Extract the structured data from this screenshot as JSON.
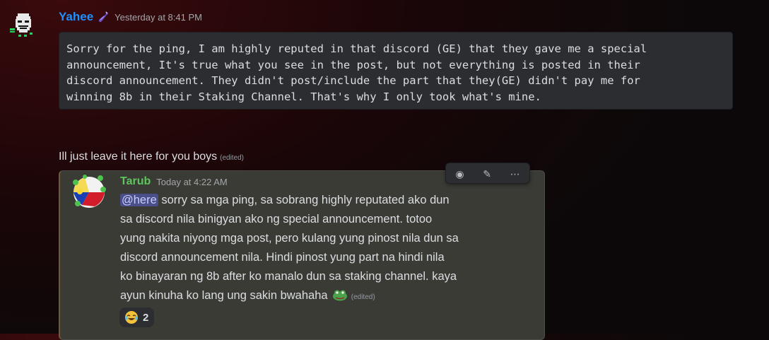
{
  "message1": {
    "username": "Yahee",
    "username_color": "#1e90ff",
    "badge_icon": "potion-icon",
    "timestamp": "Yesterday at 8:41 PM",
    "code_lines": [
      "Sorry for the ping, I am highly reputed in that discord (GE) that they gave me a special",
      "announcement, It's true what you see in the post, but not everything is posted in their",
      "discord announcement. They didn't post/include the part that they(GE) didn't pay me for",
      "winning 8b in their Staking Channel. That's why I only took what's mine."
    ]
  },
  "message2": {
    "text": "Ill just leave it here for you boys",
    "edited": "(edited)"
  },
  "embed": {
    "username": "Tarub",
    "username_color": "#5ec45e",
    "timestamp": "Today at 4:22 AM",
    "mention": "@here",
    "lines": [
      " sorry sa mga ping, sa sobrang highly reputated ako dun",
      "sa discord nila binigyan ako ng special announcement. totoo",
      "yung nakita niyong mga post, pero kulang yung pinost nila dun sa",
      "discord announcement nila. Hindi pinost yung part na hindi nila",
      "ko binayaran ng 8b after ko manalo dun sa staking channel. kaya",
      "ayun kinuha ko lang ung sakin bwahaha"
    ],
    "inline_emoji": "pepe-frog-icon",
    "edited": "(edited)",
    "reaction": {
      "emoji": "joy-emoji-icon",
      "count": "2"
    }
  }
}
